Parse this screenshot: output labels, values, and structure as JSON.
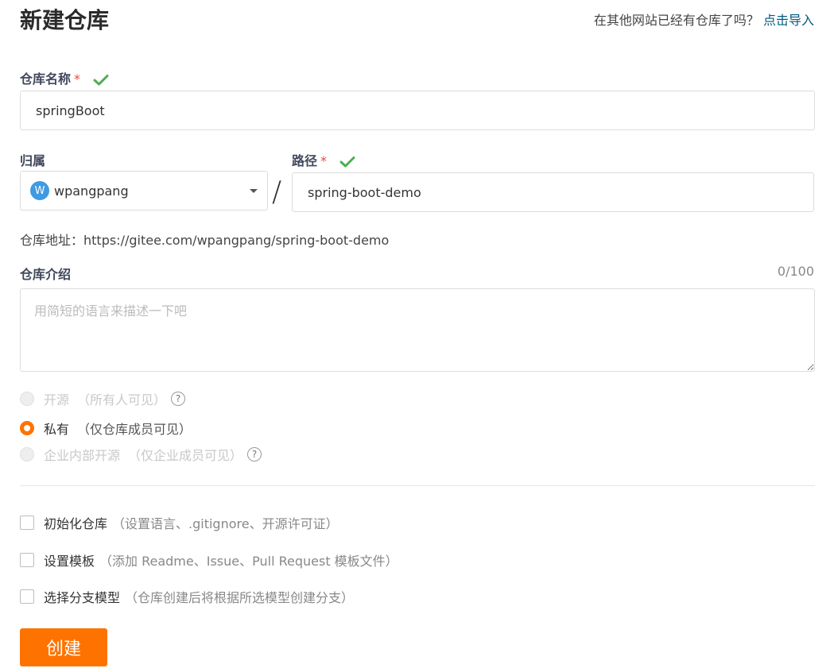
{
  "header": {
    "title": "新建仓库",
    "import_hint": "在其他网站已经有仓库了吗？",
    "import_link": "点击导入"
  },
  "repo_name": {
    "label": "仓库名称",
    "required_mark": "*",
    "value": "springBoot"
  },
  "owner": {
    "label": "归属",
    "avatar_letter": "W",
    "value": "wpangpang"
  },
  "path": {
    "separator": "/",
    "label": "路径",
    "required_mark": "*",
    "value": "spring-boot-demo"
  },
  "repo_url": {
    "text": "仓库地址：https://gitee.com/wpangpang/spring-boot-demo"
  },
  "description": {
    "label": "仓库介绍",
    "counter": "0/100",
    "placeholder": "用简短的语言来描述一下吧"
  },
  "visibility": {
    "options": [
      {
        "label": "开源",
        "note": "（所有人可见）",
        "state": "disabled"
      },
      {
        "label": "私有",
        "note": "（仅仓库成员可见）",
        "state": "checked"
      },
      {
        "label": "企业内部开源",
        "note": "（仅企业成员可见）",
        "state": "disabled"
      }
    ]
  },
  "options": [
    {
      "label": "初始化仓库",
      "note": "（设置语言、.gitignore、开源许可证）"
    },
    {
      "label": "设置模板",
      "note": "（添加 Readme、Issue、Pull Request 模板文件）"
    },
    {
      "label": "选择分支模型",
      "note": "（仓库创建后将根据所选模型创建分支）"
    }
  ],
  "submit": {
    "label": "创建"
  },
  "colors": {
    "accent": "#fe7300",
    "link": "#005980",
    "success": "#4caf50",
    "required": "#e74c3c"
  }
}
